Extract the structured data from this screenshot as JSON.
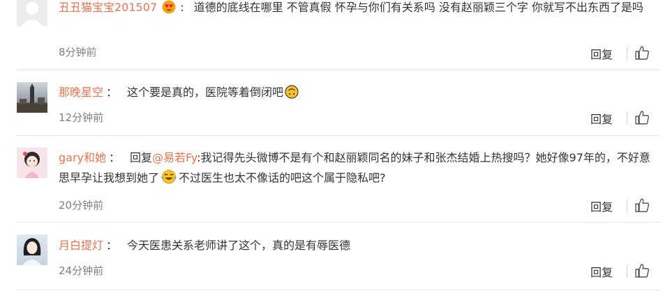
{
  "comments": [
    {
      "user": "丑丑猫宝宝201507",
      "separator": ":",
      "text_part1": "道德的底线在哪里 不管真假 怀孕与你们有关系吗 没有赵丽颖三个字 你就写不出东西了是吗",
      "time": "8分钟前",
      "reply_label": "回复",
      "emoji": "heart-eyes-emoji"
    },
    {
      "user": "那晚星空",
      "separator": "：",
      "text_part1": "这个要是真的，医院等着倒闭吧",
      "time": "12分钟前",
      "reply_label": "回复",
      "emoji": "upside-down-face-emoji"
    },
    {
      "user": "gary和她",
      "separator": "：",
      "reply_prefix": "回复",
      "mention": "@易若Fy",
      "text_part1": ":我记得先头微博不是有个和赵丽颖同名的妹子和张杰结婚上热搜吗？她好像97年的，不好意思早孕让我想到她了",
      "text_part2": "不过医生也太不像话的吧这个属于隐私吧?",
      "time": "20分钟前",
      "reply_label": "回复",
      "emoji": "crying-laughing-emoji"
    },
    {
      "user": "月白提灯",
      "separator": "：",
      "text_part1": "今天医患关系老师讲了这个，真的是有辱医德",
      "time": "24分钟前",
      "reply_label": "回复"
    }
  ],
  "colors": {
    "username": "#eb7350",
    "text": "#333333",
    "time": "#808080",
    "divider": "#e6e6e6"
  },
  "icons": {
    "like": "thumbs-up-icon",
    "avatar": "user-avatar"
  }
}
